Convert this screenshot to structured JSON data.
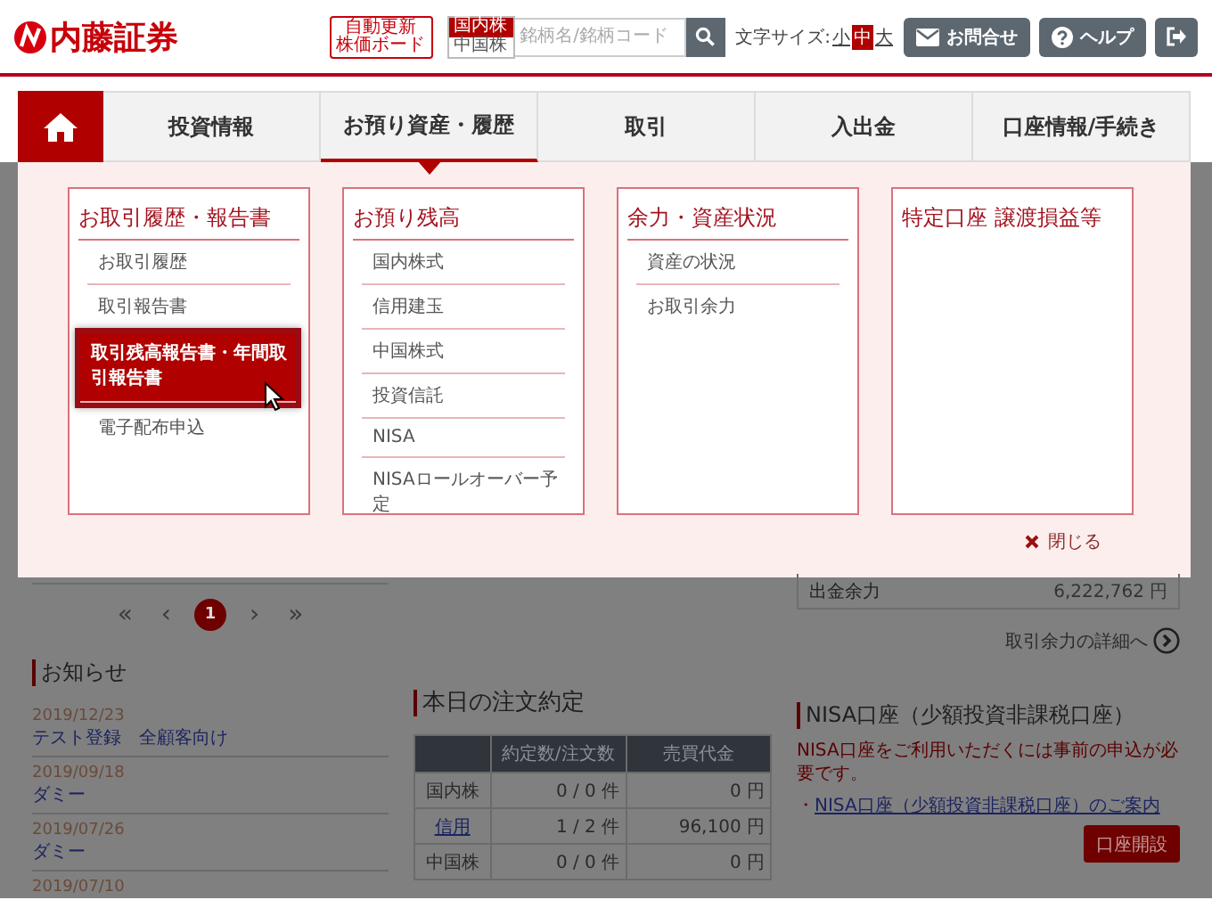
{
  "header": {
    "logo": "内藤証券",
    "board_button": [
      "自動更新",
      "株価ボード"
    ],
    "markets": [
      {
        "label": "国内株",
        "selected": true
      },
      {
        "label": "中国株",
        "selected": false
      }
    ],
    "search": {
      "placeholder": "銘柄名/銘柄コード"
    },
    "font_size": {
      "label": "文字サイズ:",
      "options": [
        {
          "label": "小",
          "selected": false
        },
        {
          "label": "中",
          "selected": true
        },
        {
          "label": "大",
          "selected": false
        }
      ]
    },
    "buttons": [
      {
        "kind": "mail",
        "label": "お問合せ"
      },
      {
        "kind": "help",
        "label": "ヘルプ"
      },
      {
        "kind": "logout"
      }
    ]
  },
  "nav": {
    "tabs": [
      {
        "label": "投資情報",
        "selected": false
      },
      {
        "label": "お預り資産・履歴",
        "selected": true
      },
      {
        "label": "取引",
        "selected": false
      },
      {
        "label": "入出金",
        "selected": false
      },
      {
        "label": "口座情報/手続き",
        "selected": false
      }
    ]
  },
  "mega_menu": {
    "columns": [
      {
        "heading": "お取引履歴・報告書",
        "items": [
          {
            "label": "お取引履歴",
            "selected": false
          },
          {
            "label": "取引報告書",
            "selected": false
          },
          {
            "label": "取引残高報告書・年間取引報告書",
            "selected": true
          },
          {
            "label": "電子配布申込",
            "selected": false
          }
        ]
      },
      {
        "heading": "お預り残高",
        "items": [
          {
            "label": "国内株式",
            "selected": false
          },
          {
            "label": "信用建玉",
            "selected": false
          },
          {
            "label": "中国株式",
            "selected": false
          },
          {
            "label": "投資信託",
            "selected": false
          },
          {
            "label": "NISA",
            "selected": false
          },
          {
            "label": "NISAロールオーバー予定",
            "selected": false
          }
        ]
      },
      {
        "heading": "余力・資産状況",
        "items": [
          {
            "label": "資産の状況",
            "selected": false
          },
          {
            "label": "お取引余力",
            "selected": false
          }
        ]
      },
      {
        "heading": "特定口座 譲渡損益等"
      }
    ],
    "close": "閉じる"
  },
  "pagination": {
    "first": "«",
    "prev": "‹",
    "pages": [
      {
        "label": "1",
        "selected": true
      }
    ],
    "next": "›",
    "last": "»"
  },
  "news": {
    "title": "お知らせ",
    "items": [
      {
        "date": "2019/12/23",
        "title": "テスト登録　全顧客向け"
      },
      {
        "date": "2019/09/18",
        "title": "ダミー"
      },
      {
        "date": "2019/07/26",
        "title": "ダミー"
      },
      {
        "date": "2019/07/10"
      }
    ]
  },
  "orders": {
    "title": "本日の注文約定",
    "columns": [
      "約定数/注文数",
      "売買代金"
    ],
    "rows": [
      {
        "kind": "text",
        "label": "国内株",
        "count": "0 / 0 件",
        "amount": "0 円"
      },
      {
        "kind": "link",
        "label": "信用",
        "count": "1 / 2 件",
        "amount": "96,100 円"
      },
      {
        "kind": "text",
        "label": "中国株",
        "count": "0 / 0 件",
        "amount": "0 円"
      }
    ]
  },
  "balance": {
    "label": "出金余力",
    "value": "6,222,762",
    "unit": "円",
    "detail_link": "取引余力の詳細へ"
  },
  "nisa": {
    "title": "NISA口座（少額投資非課税口座）",
    "notice": "NISA口座をご利用いただくには事前の申込が必要です。",
    "bullet": "・",
    "link": "NISA口座（少額投資非課税口座）のご案内",
    "button": "口座開設"
  }
}
